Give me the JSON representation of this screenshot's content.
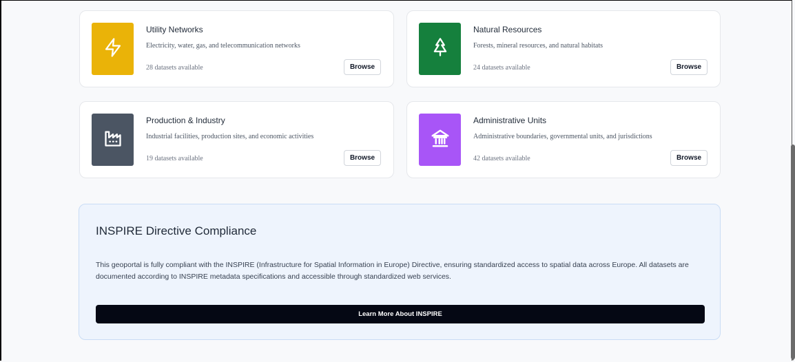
{
  "categories": [
    {
      "title": "Utility Networks",
      "description": "Electricity, water, gas, and telecommunication networks",
      "count": "28 datasets available",
      "browse": "Browse",
      "icon": "lightning-icon",
      "color": "#eab308"
    },
    {
      "title": "Natural Resources",
      "description": "Forests, mineral resources, and natural habitats",
      "count": "24 datasets available",
      "browse": "Browse",
      "icon": "tree-icon",
      "color": "#15803d"
    },
    {
      "title": "Production & Industry",
      "description": "Industrial facilities, production sites, and economic activities",
      "count": "19 datasets available",
      "browse": "Browse",
      "icon": "factory-icon",
      "color": "#4b5563"
    },
    {
      "title": "Administrative Units",
      "description": "Administrative boundaries, governmental units, and jurisdictions",
      "count": "42 datasets available",
      "browse": "Browse",
      "icon": "landmark-icon",
      "color": "#a855f7"
    }
  ],
  "inspire": {
    "heading": "INSPIRE Directive Compliance",
    "paragraph": "This geoportal is fully compliant with the INSPIRE (Infrastructure for Spatial Information in Europe) Directive, ensuring standardized access to spatial data across Europe. All datasets are documented according to INSPIRE metadata specifications and accessible through standardized web services.",
    "button": "Learn More About INSPIRE"
  }
}
